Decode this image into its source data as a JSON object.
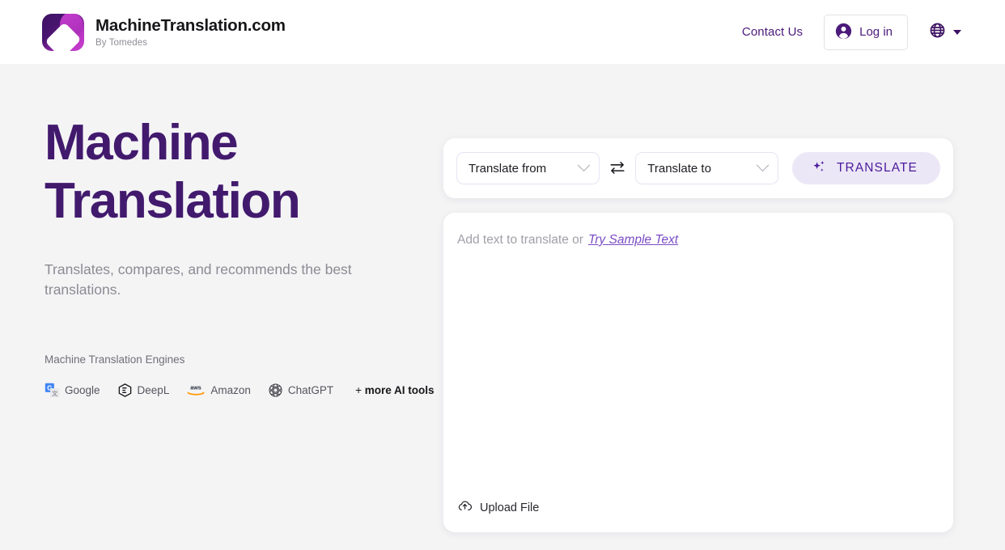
{
  "header": {
    "brand_title": "MachineTranslation.com",
    "brand_subtitle": "By Tomedes",
    "logo_icon": "machine-translation-logo",
    "contact_label": "Contact Us",
    "login_label": "Log in",
    "login_icon": "account-circle-icon",
    "language_icon": "globe-icon",
    "language_caret_icon": "chevron-down-icon"
  },
  "hero": {
    "title": "Machine Translation",
    "subtitle": "Translates, compares, and recommends the best translations.",
    "engines_label": "Machine Translation Engines",
    "engines": [
      {
        "name": "Google",
        "icon": "google-translate-icon"
      },
      {
        "name": "DeepL",
        "icon": "deepl-icon"
      },
      {
        "name": "Amazon",
        "icon": "aws-icon"
      },
      {
        "name": "ChatGPT",
        "icon": "openai-icon"
      }
    ],
    "more_tools_prefix": "+ ",
    "more_tools_label": "more AI tools"
  },
  "toolbar": {
    "source_language": "Translate from",
    "target_language": "Translate to",
    "swap_icon": "swap-horizontal-icon",
    "source_chevron_icon": "chevron-down-icon",
    "target_chevron_icon": "chevron-down-icon",
    "translate_label": "TRANSLATE",
    "translate_icon": "sparkles-icon"
  },
  "editor": {
    "placeholder_text": "Add text to translate or",
    "sample_link_label": "Try Sample Text",
    "upload_label": "Upload File",
    "upload_icon": "cloud-upload-icon",
    "textarea_value": ""
  },
  "colors": {
    "brand_purple": "#421a6d",
    "accent_purple": "#4b1a9c",
    "button_bg": "#ece7f6",
    "page_bg": "#f4f4f5",
    "muted_text": "#8b8b93"
  }
}
